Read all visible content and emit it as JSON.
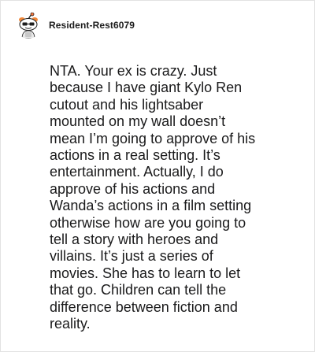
{
  "comment": {
    "author": "Resident-Rest6079",
    "avatar_icon": "reddit-snoo-avatar-icon",
    "body": "NTA. Your ex is crazy. Just\nbecause I have giant Kylo Ren\ncutout and his lightsaber\nmounted on my wall doesn’t\nmean I’m going to approve of his\nactions in a real setting. It’s\nentertainment. Actually, I do\napprove of his actions and\nWanda’s actions in a film setting\notherwise how are you going to\ntell a story with heroes and\nvillains. It’s just a series of\nmovies. She has to learn to let\nthat go. Children can tell the\ndifference between fiction and\nreality."
  },
  "colors": {
    "text": "#1a1a1b",
    "avatar_accent": "#ff4500",
    "border": "#e2e2e2"
  }
}
